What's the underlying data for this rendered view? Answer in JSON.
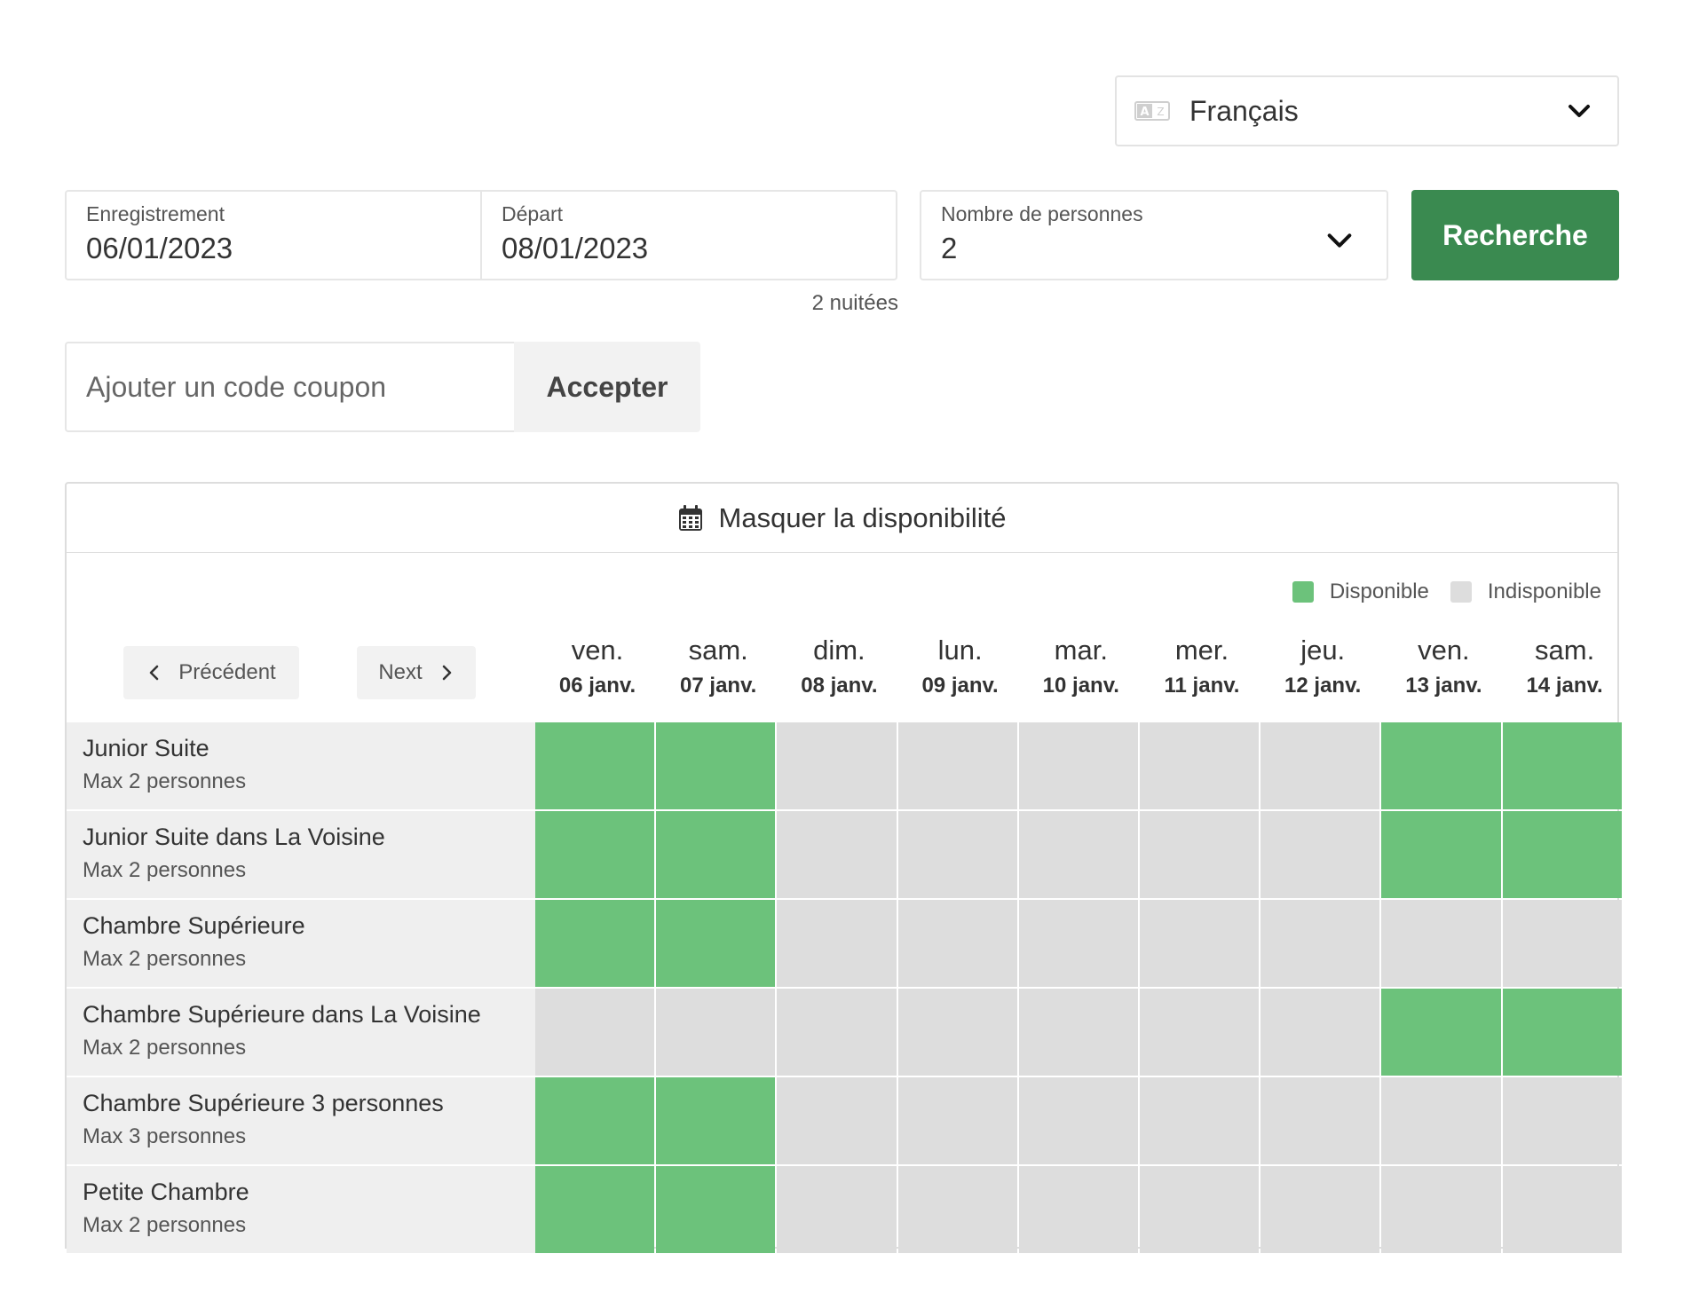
{
  "language": {
    "icon": "language-icon",
    "selected": "Français"
  },
  "search": {
    "checkin": {
      "label": "Enregistrement",
      "value": "06/01/2023"
    },
    "checkout": {
      "label": "Départ",
      "value": "08/01/2023"
    },
    "guests": {
      "label": "Nombre de personnes",
      "value": "2"
    },
    "button": "Recherche",
    "nights": "2 nuitées"
  },
  "coupon": {
    "placeholder": "Ajouter un code coupon",
    "button": "Accepter"
  },
  "availability": {
    "toggle_label": "Masquer la disponibilité",
    "legend": {
      "available": "Disponible",
      "unavailable": "Indisponible"
    },
    "colors": {
      "available": "#6cc27b",
      "unavailable": "#dddddd",
      "accent": "#3a8a50"
    },
    "prev": "Précédent",
    "next": "Next",
    "days": [
      {
        "name": "ven.",
        "date": "06 janv."
      },
      {
        "name": "sam.",
        "date": "07 janv."
      },
      {
        "name": "dim.",
        "date": "08 janv."
      },
      {
        "name": "lun.",
        "date": "09 janv."
      },
      {
        "name": "mar.",
        "date": "10 janv."
      },
      {
        "name": "mer.",
        "date": "11 janv."
      },
      {
        "name": "jeu.",
        "date": "12 janv."
      },
      {
        "name": "ven.",
        "date": "13 janv."
      },
      {
        "name": "sam.",
        "date": "14 janv."
      }
    ],
    "rooms": [
      {
        "name": "Junior Suite",
        "max": "Max 2 personnes",
        "avail": [
          1,
          1,
          0,
          0,
          0,
          0,
          0,
          1,
          1
        ]
      },
      {
        "name": "Junior Suite dans La Voisine",
        "max": "Max 2 personnes",
        "avail": [
          1,
          1,
          0,
          0,
          0,
          0,
          0,
          1,
          1
        ]
      },
      {
        "name": "Chambre Supérieure",
        "max": "Max 2 personnes",
        "avail": [
          1,
          1,
          0,
          0,
          0,
          0,
          0,
          0,
          0
        ]
      },
      {
        "name": "Chambre Supérieure dans La Voisine",
        "max": "Max 2 personnes",
        "avail": [
          0,
          0,
          0,
          0,
          0,
          0,
          0,
          1,
          1
        ]
      },
      {
        "name": "Chambre Supérieure 3 personnes",
        "max": "Max 3 personnes",
        "avail": [
          1,
          1,
          0,
          0,
          0,
          0,
          0,
          0,
          0
        ]
      },
      {
        "name": "Petite Chambre",
        "max": "Max 2 personnes",
        "avail": [
          1,
          1,
          0,
          0,
          0,
          0,
          0,
          0,
          0
        ]
      }
    ]
  }
}
